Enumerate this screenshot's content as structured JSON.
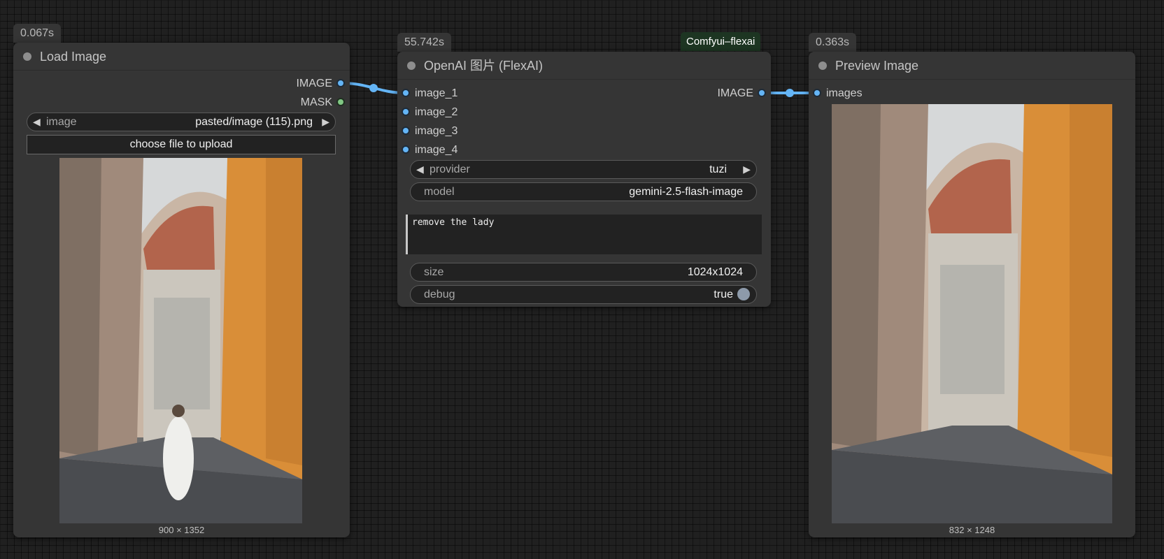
{
  "colors": {
    "canvas": "#202020",
    "node_body": "#353535",
    "image_port": "#64b5f6",
    "mask_port": "#81c784",
    "link": "#64b5f6",
    "group_tag": "#1d3522"
  },
  "load_image": {
    "timing": "0.067s",
    "title": "Load Image",
    "outputs": [
      "IMAGE",
      "MASK"
    ],
    "image_widget": {
      "label": "image",
      "value": "pasted/image (115).png"
    },
    "upload_label": "choose file to upload",
    "image_alt": "Florence street with cathedral and woman in white dress",
    "dims": "900 × 1352"
  },
  "flexai": {
    "timing": "55.742s",
    "group": "Comfyui–flexai",
    "title": "OpenAI 图片 (FlexAI)",
    "inputs": [
      "image_1",
      "image_2",
      "image_3",
      "image_4"
    ],
    "output": "IMAGE",
    "provider": {
      "label": "provider",
      "value": "tuzi"
    },
    "model": {
      "label": "model",
      "value": "gemini-2.5-flash-image"
    },
    "prompt": "remove the lady",
    "size": {
      "label": "size",
      "value": "1024x1024"
    },
    "debug": {
      "label": "debug",
      "value": "true"
    }
  },
  "preview": {
    "timing": "0.363s",
    "title": "Preview Image",
    "input": "images",
    "image_alt": "Florence street with cathedral, empty",
    "dims": "832 × 1248"
  }
}
